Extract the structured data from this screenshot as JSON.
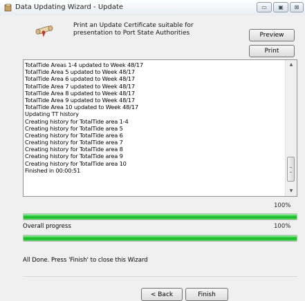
{
  "window": {
    "title": "Data Updating Wizard - Update",
    "minimize_glyph": "▭",
    "maximize_glyph": "▣",
    "close_glyph": "⊠"
  },
  "certificate": {
    "text": "Print an Update Certificate suitable for presentation to Port State Authorities",
    "preview_label": "Preview",
    "print_label": "Print",
    "icon": "certificate-scroll-icon"
  },
  "log": {
    "lines": [
      "TotalTide Areas 1-4 updated to Week 48/17",
      "TotalTide Area 5 updated to Week 48/17",
      "TotalTide Area 6 updated to Week 48/17",
      "TotalTide Area 7 updated to Week 48/17",
      "TotalTide Area 8 updated to Week 48/17",
      "TotalTide Area 9 updated to Week 48/17",
      "TotalTide Area 10 updated to Week 48/17",
      "Updating TT history",
      "Creating history for TotalTide area 1-4",
      "Creating history for TotalTide area 5",
      "Creating history for TotalTide area 6",
      "Creating history for TotalTide area 7",
      "Creating history for TotalTide area 8",
      "Creating history for TotalTide area 9",
      "Creating history for TotalTide area 10",
      "Finished in 00:00:51"
    ],
    "scroll_up_glyph": "▲",
    "scroll_down_glyph": "▼"
  },
  "progress": {
    "current_percent_text": "100%",
    "current_fraction": 1.0,
    "overall_label": "Overall progress",
    "overall_percent_text": "100%",
    "overall_fraction": 1.0,
    "bar_color": "#22c532"
  },
  "status": {
    "message": "All Done. Press 'Finish' to close this Wizard"
  },
  "footer": {
    "back_label": "< Back",
    "finish_label": "Finish"
  }
}
